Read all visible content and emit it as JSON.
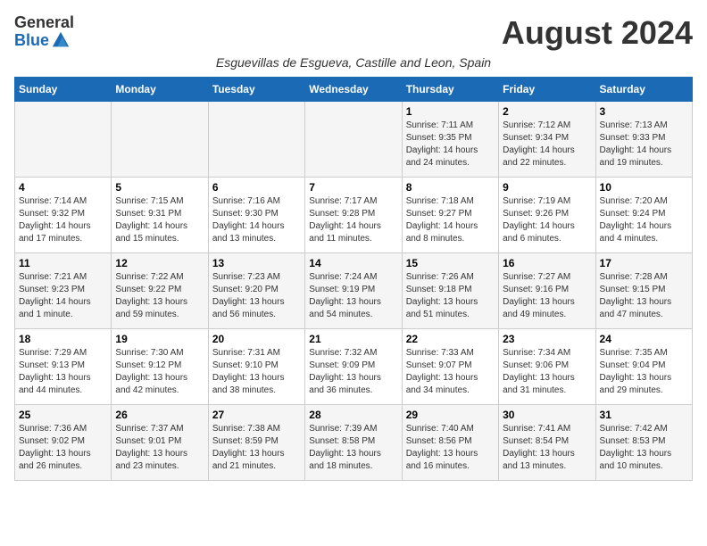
{
  "logo": {
    "general": "General",
    "blue": "Blue"
  },
  "title": "August 2024",
  "subtitle": "Esguevillas de Esgueva, Castille and Leon, Spain",
  "weekdays": [
    "Sunday",
    "Monday",
    "Tuesday",
    "Wednesday",
    "Thursday",
    "Friday",
    "Saturday"
  ],
  "weeks": [
    [
      {
        "day": "",
        "info": ""
      },
      {
        "day": "",
        "info": ""
      },
      {
        "day": "",
        "info": ""
      },
      {
        "day": "",
        "info": ""
      },
      {
        "day": "1",
        "info": "Sunrise: 7:11 AM\nSunset: 9:35 PM\nDaylight: 14 hours and 24 minutes."
      },
      {
        "day": "2",
        "info": "Sunrise: 7:12 AM\nSunset: 9:34 PM\nDaylight: 14 hours and 22 minutes."
      },
      {
        "day": "3",
        "info": "Sunrise: 7:13 AM\nSunset: 9:33 PM\nDaylight: 14 hours and 19 minutes."
      }
    ],
    [
      {
        "day": "4",
        "info": "Sunrise: 7:14 AM\nSunset: 9:32 PM\nDaylight: 14 hours and 17 minutes."
      },
      {
        "day": "5",
        "info": "Sunrise: 7:15 AM\nSunset: 9:31 PM\nDaylight: 14 hours and 15 minutes."
      },
      {
        "day": "6",
        "info": "Sunrise: 7:16 AM\nSunset: 9:30 PM\nDaylight: 14 hours and 13 minutes."
      },
      {
        "day": "7",
        "info": "Sunrise: 7:17 AM\nSunset: 9:28 PM\nDaylight: 14 hours and 11 minutes."
      },
      {
        "day": "8",
        "info": "Sunrise: 7:18 AM\nSunset: 9:27 PM\nDaylight: 14 hours and 8 minutes."
      },
      {
        "day": "9",
        "info": "Sunrise: 7:19 AM\nSunset: 9:26 PM\nDaylight: 14 hours and 6 minutes."
      },
      {
        "day": "10",
        "info": "Sunrise: 7:20 AM\nSunset: 9:24 PM\nDaylight: 14 hours and 4 minutes."
      }
    ],
    [
      {
        "day": "11",
        "info": "Sunrise: 7:21 AM\nSunset: 9:23 PM\nDaylight: 14 hours and 1 minute."
      },
      {
        "day": "12",
        "info": "Sunrise: 7:22 AM\nSunset: 9:22 PM\nDaylight: 13 hours and 59 minutes."
      },
      {
        "day": "13",
        "info": "Sunrise: 7:23 AM\nSunset: 9:20 PM\nDaylight: 13 hours and 56 minutes."
      },
      {
        "day": "14",
        "info": "Sunrise: 7:24 AM\nSunset: 9:19 PM\nDaylight: 13 hours and 54 minutes."
      },
      {
        "day": "15",
        "info": "Sunrise: 7:26 AM\nSunset: 9:18 PM\nDaylight: 13 hours and 51 minutes."
      },
      {
        "day": "16",
        "info": "Sunrise: 7:27 AM\nSunset: 9:16 PM\nDaylight: 13 hours and 49 minutes."
      },
      {
        "day": "17",
        "info": "Sunrise: 7:28 AM\nSunset: 9:15 PM\nDaylight: 13 hours and 47 minutes."
      }
    ],
    [
      {
        "day": "18",
        "info": "Sunrise: 7:29 AM\nSunset: 9:13 PM\nDaylight: 13 hours and 44 minutes."
      },
      {
        "day": "19",
        "info": "Sunrise: 7:30 AM\nSunset: 9:12 PM\nDaylight: 13 hours and 42 minutes."
      },
      {
        "day": "20",
        "info": "Sunrise: 7:31 AM\nSunset: 9:10 PM\nDaylight: 13 hours and 38 minutes."
      },
      {
        "day": "21",
        "info": "Sunrise: 7:32 AM\nSunset: 9:09 PM\nDaylight: 13 hours and 36 minutes."
      },
      {
        "day": "22",
        "info": "Sunrise: 7:33 AM\nSunset: 9:07 PM\nDaylight: 13 hours and 34 minutes."
      },
      {
        "day": "23",
        "info": "Sunrise: 7:34 AM\nSunset: 9:06 PM\nDaylight: 13 hours and 31 minutes."
      },
      {
        "day": "24",
        "info": "Sunrise: 7:35 AM\nSunset: 9:04 PM\nDaylight: 13 hours and 29 minutes."
      }
    ],
    [
      {
        "day": "25",
        "info": "Sunrise: 7:36 AM\nSunset: 9:02 PM\nDaylight: 13 hours and 26 minutes."
      },
      {
        "day": "26",
        "info": "Sunrise: 7:37 AM\nSunset: 9:01 PM\nDaylight: 13 hours and 23 minutes."
      },
      {
        "day": "27",
        "info": "Sunrise: 7:38 AM\nSunset: 8:59 PM\nDaylight: 13 hours and 21 minutes."
      },
      {
        "day": "28",
        "info": "Sunrise: 7:39 AM\nSunset: 8:58 PM\nDaylight: 13 hours and 18 minutes."
      },
      {
        "day": "29",
        "info": "Sunrise: 7:40 AM\nSunset: 8:56 PM\nDaylight: 13 hours and 16 minutes."
      },
      {
        "day": "30",
        "info": "Sunrise: 7:41 AM\nSunset: 8:54 PM\nDaylight: 13 hours and 13 minutes."
      },
      {
        "day": "31",
        "info": "Sunrise: 7:42 AM\nSunset: 8:53 PM\nDaylight: 13 hours and 10 minutes."
      }
    ]
  ]
}
